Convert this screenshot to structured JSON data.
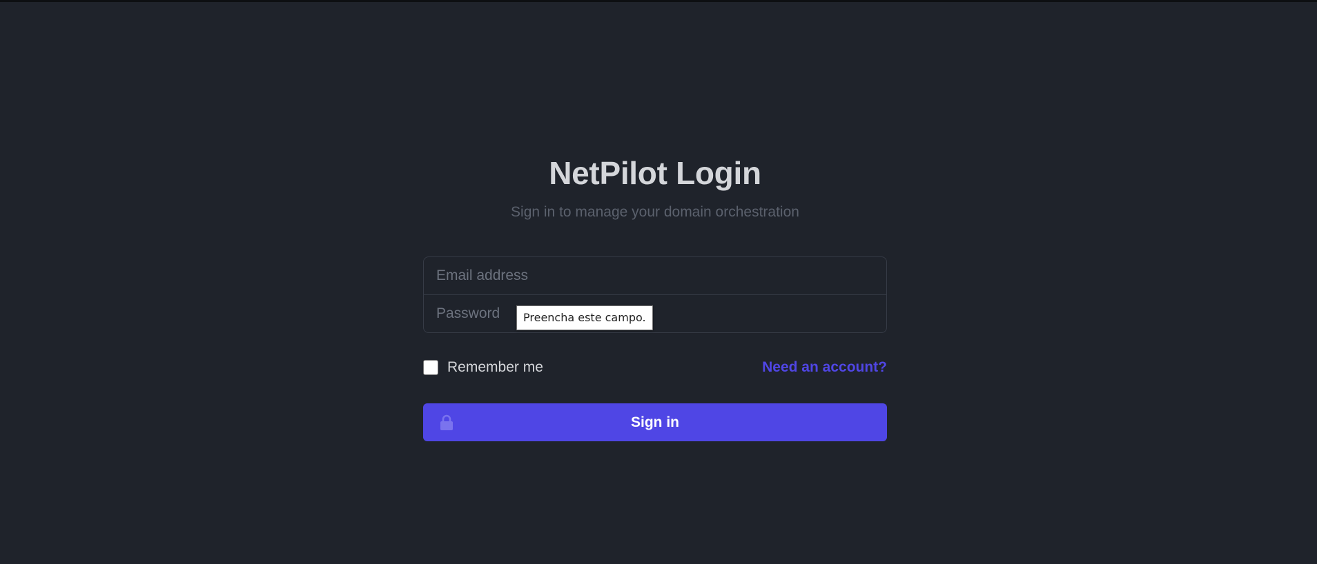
{
  "header": {
    "title": "NetPilot Login",
    "subtitle": "Sign in to manage your domain orchestration"
  },
  "form": {
    "email_placeholder": "Email address",
    "email_value": "",
    "password_placeholder": "Password",
    "password_value": "",
    "validation_tooltip": "Preencha este campo.",
    "remember_label": "Remember me",
    "remember_checked": false,
    "need_account_label": "Need an account?",
    "signin_label": "Sign in",
    "signin_icon": "lock-icon"
  },
  "colors": {
    "background": "#1f232b",
    "accent": "#4f46e5",
    "link": "#5046e5",
    "title": "#d4d6da",
    "subtitle": "#5b616d"
  }
}
